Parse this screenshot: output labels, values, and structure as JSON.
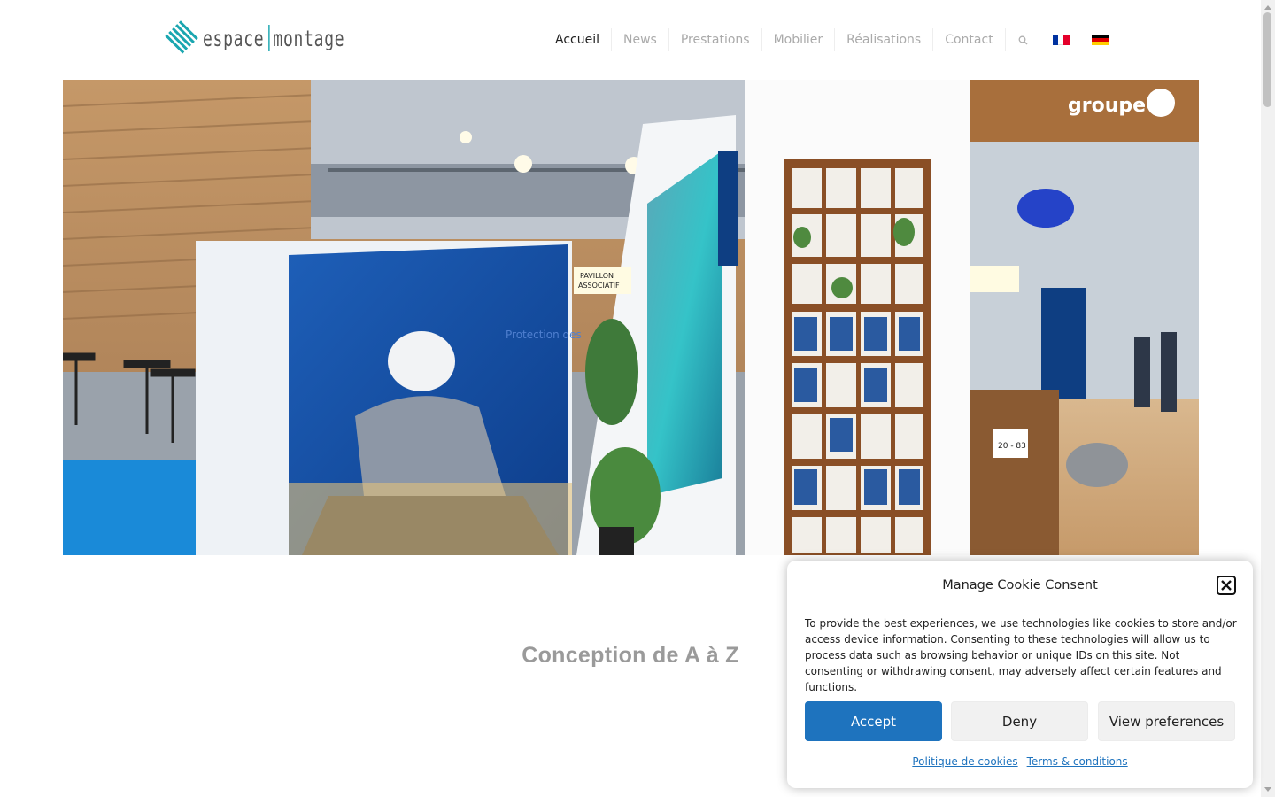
{
  "brand": {
    "logo_left": "espace",
    "logo_right": "montage",
    "accent_color": "#1aa6b0"
  },
  "nav": {
    "items": [
      {
        "label": "Accueil",
        "active": true
      },
      {
        "label": "News",
        "active": false
      },
      {
        "label": "Prestations",
        "active": false
      },
      {
        "label": "Mobilier",
        "active": false
      },
      {
        "label": "Réalisations",
        "active": false
      },
      {
        "label": "Contact",
        "active": false
      }
    ],
    "search_icon": "search-icon",
    "languages": [
      "fr-flag-icon",
      "de-flag-icon"
    ]
  },
  "hero": {
    "banner_text": "groupe",
    "pavillon_label_1": "PAVILLON",
    "pavillon_label_2": "ASSOCIATIF",
    "poster_text": "Protection des installations sanitaires",
    "booth_number": "20 - 83"
  },
  "main": {
    "section_title": "Conception de A à Z"
  },
  "cookie": {
    "title": "Manage Cookie Consent",
    "body": "To provide the best experiences, we use technologies like cookies to store and/or access device information. Consenting to these technologies will allow us to process data such as browsing behavior or unique IDs on this site. Not consenting or withdrawing consent, may adversely affect certain features and functions.",
    "accept_label": "Accept",
    "deny_label": "Deny",
    "preferences_label": "View preferences",
    "cookie_policy_link": "Politique de cookies",
    "terms_link": "Terms & conditions",
    "accept_color": "#1e73be"
  }
}
